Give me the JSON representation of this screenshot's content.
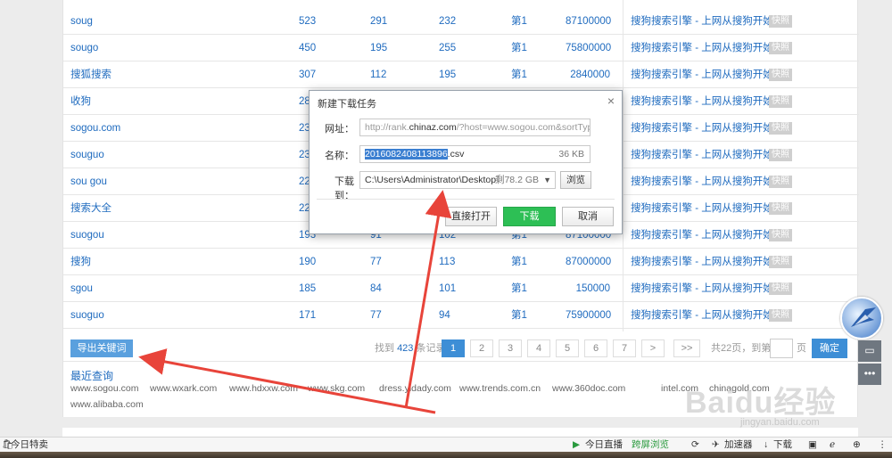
{
  "table": {
    "rows": [
      {
        "keyword": "soug",
        "a": "523",
        "b": "291",
        "c": "232",
        "rank": "第1",
        "results": "87100000",
        "title": "搜狗搜索引擎 - 上网从搜狗开始",
        "snapshot": "快照"
      },
      {
        "keyword": "sougo",
        "a": "450",
        "b": "195",
        "c": "255",
        "rank": "第1",
        "results": "75800000",
        "title": "搜狗搜索引擎 - 上网从搜狗开始",
        "snapshot": "快照"
      },
      {
        "keyword": "搜狐搜索",
        "a": "307",
        "b": "112",
        "c": "195",
        "rank": "第1",
        "results": "2840000",
        "title": "搜狗搜索引擎 - 上网从搜狗开始",
        "snapshot": "快照"
      },
      {
        "keyword": "收狗",
        "a": "28",
        "b": "",
        "c": "",
        "rank": "",
        "results": "",
        "title": "搜狗搜索引擎 - 上网从搜狗开始",
        "snapshot": "快照"
      },
      {
        "keyword": "sogou.com",
        "a": "23",
        "b": "",
        "c": "",
        "rank": "",
        "results": "",
        "title": "搜狗搜索引擎 - 上网从搜狗开始",
        "snapshot": "快照"
      },
      {
        "keyword": "souguo",
        "a": "23",
        "b": "",
        "c": "",
        "rank": "",
        "results": "",
        "title": "搜狗搜索引擎 - 上网从搜狗开始",
        "snapshot": "快照"
      },
      {
        "keyword": "sou gou",
        "a": "22",
        "b": "",
        "c": "",
        "rank": "",
        "results": "",
        "title": "搜狗搜索引擎 - 上网从搜狗开始",
        "snapshot": "快照"
      },
      {
        "keyword": "搜索大全",
        "a": "22",
        "b": "",
        "c": "",
        "rank": "",
        "results": "",
        "title": "搜狗搜索引擎 - 上网从搜狗开始",
        "snapshot": "快照"
      },
      {
        "keyword": "suogou",
        "a": "193",
        "b": "91",
        "c": "102",
        "rank": "第1",
        "results": "87100000",
        "title": "搜狗搜索引擎 - 上网从搜狗开始",
        "snapshot": "快照"
      },
      {
        "keyword": "搜狗",
        "a": "190",
        "b": "77",
        "c": "113",
        "rank": "第1",
        "results": "87000000",
        "title": "搜狗搜索引擎 - 上网从搜狗开始",
        "snapshot": "快照"
      },
      {
        "keyword": "sgou",
        "a": "185",
        "b": "84",
        "c": "101",
        "rank": "第1",
        "results": "150000",
        "title": "搜狗搜索引擎 - 上网从搜狗开始",
        "snapshot": "快照"
      },
      {
        "keyword": "suoguo",
        "a": "171",
        "b": "77",
        "c": "94",
        "rank": "第1",
        "results": "75900000",
        "title": "搜狗搜索引擎 - 上网从搜狗开始",
        "snapshot": "快照"
      }
    ]
  },
  "pager": {
    "export_label": "导出关键词",
    "found_prefix": "找到",
    "found_count": "423",
    "found_suffix": "条记录",
    "pages": [
      "1",
      "2",
      "3",
      "4",
      "5",
      "6",
      "7",
      ">",
      ">>"
    ],
    "active_page": "1",
    "total_text": "共22页，到第",
    "page_suffix": "页",
    "confirm_label": "确定"
  },
  "recent": {
    "title": "最近查询",
    "links": [
      "www.sogou.com",
      "www.wxark.com",
      "www.hdxxw.com",
      "www.skg.com",
      "dress.yidady.com",
      "www.trends.com.cn",
      "www.360doc.com",
      "intel.com",
      "chinagold.com",
      "www.alibaba.com"
    ]
  },
  "dialog": {
    "title": "新建下载任务",
    "close": "×",
    "url_label": "网址：",
    "url_prefix": "http://rank.",
    "url_domain": "chinaz.com",
    "url_suffix": "/?host=www.sogou.com&sortType=",
    "name_label": "名称：",
    "name_selected": "2016082408113896",
    "name_ext": ".csv",
    "name_size": "36 KB",
    "path_label": "下载到：",
    "path_value": "C:\\Users\\Administrator\\Desktop",
    "path_free": "剩78.2 GB",
    "browse_label": "浏览",
    "open_label": "直接打开",
    "download_label": "下载",
    "cancel_label": "取消"
  },
  "side": {
    "feedback_icon": "comment-icon",
    "more_icon": "more-icon"
  },
  "watermark": {
    "text": "Baidu经验",
    "url": "jingyan.baidu.com"
  },
  "statusbar": {
    "left_label": "今日特卖",
    "live_label": "今日直播",
    "cross_label": "跨屏浏览",
    "speed_label": "加速器",
    "download_label": "下载"
  },
  "colors": {
    "link_blue": "#1f6bbf",
    "accent_blue": "#3d8ed6",
    "download_green": "#2dbf55",
    "arrow_red": "#e8443a"
  }
}
